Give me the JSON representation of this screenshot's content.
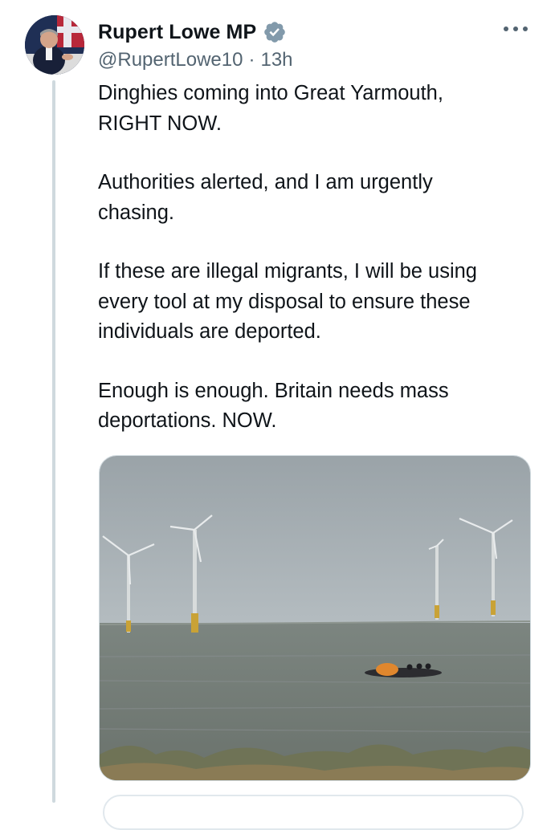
{
  "tweet": {
    "author": {
      "display_name": "Rupert Lowe MP",
      "handle": "@RupertLowe10",
      "verified": true,
      "avatar_icon": "profile-photo-avatar"
    },
    "separator": "·",
    "timestamp": "13h",
    "more_icon": "more-horizontal-icon",
    "paragraphs": [
      "Dinghies coming into Great Yarmouth,\nRIGHT NOW.",
      "Authorities alerted, and I am urgently\nchasing.",
      "If these are illegal migrants, I will be using\nevery tool at my disposal to ensure these\nindividuals are deported.",
      "Enough is enough. Britain needs mass\ndeportations. NOW."
    ],
    "media": {
      "kind": "photo",
      "subject_icon": "sea-wind-turbines-dinghy-photo"
    }
  },
  "colors": {
    "text_primary": "#0f1419",
    "text_secondary": "#536471",
    "thread_line": "#cfd9de",
    "verified_badge": "#829aab"
  }
}
